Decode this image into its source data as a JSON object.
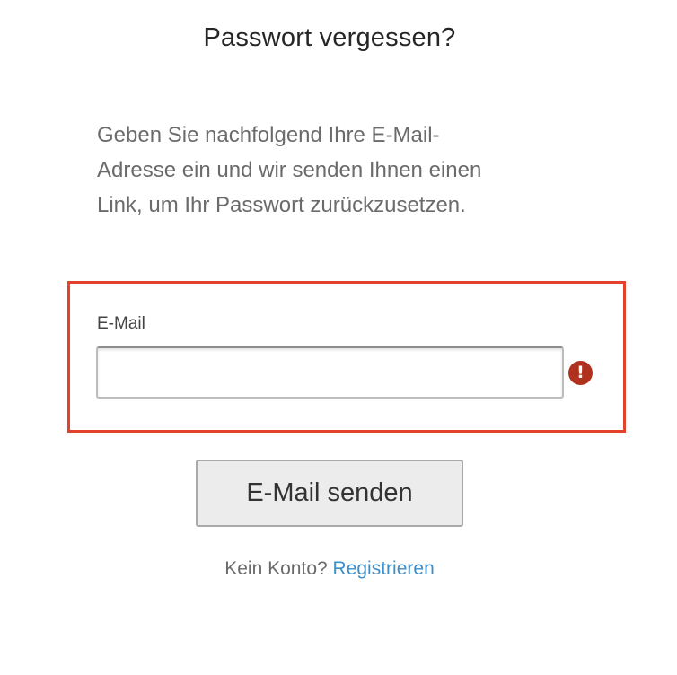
{
  "page": {
    "title": "Passwort vergessen?",
    "intro_lines": [
      "Geben Sie nachfolgend Ihre E-Mail-",
      "Adresse ein und wir senden Ihnen einen",
      "Link, um Ihr Passwort zurückzusetzen."
    ]
  },
  "form": {
    "email_label": "E-Mail",
    "email_value": "",
    "email_placeholder": "",
    "error_icon": "exclamation-circle-icon",
    "error_icon_glyph": "!",
    "highlight_color": "#e2412b",
    "error_color": "#b0311d",
    "submit_label": "E-Mail senden"
  },
  "footer": {
    "text": "Kein Konto?",
    "link_label": "Registrieren",
    "link_color": "#3d8fc9"
  }
}
